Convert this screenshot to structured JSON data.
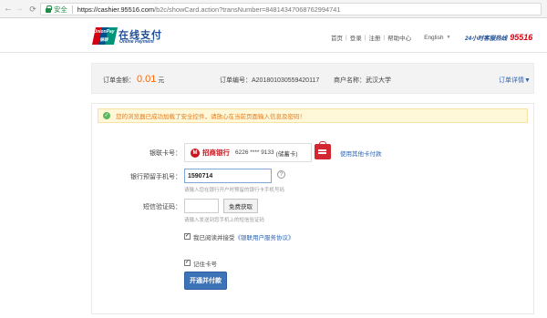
{
  "browser": {
    "secure_label": "安全",
    "url_host": "https://cashier.95516.com",
    "url_path": "/b2c/showCard.action?transNumber=84814347068762994741"
  },
  "header": {
    "logo_cn": "在线支付",
    "logo_en": "Online Payment",
    "logo_mark_top": "UnionPay",
    "logo_mark_bottom": "银联",
    "nav": [
      "首页",
      "登录",
      "注册",
      "帮助中心"
    ],
    "language": "English",
    "hotline_label": "24小时客服热线",
    "hotline_number": "95516"
  },
  "order": {
    "amount_label": "订单金额：",
    "amount_value": "0.01",
    "amount_unit": "元",
    "order_number": "订单编号：A20180103055942011​7",
    "merchant": "商户名称：武汉大学",
    "details_link": "订单详情▼"
  },
  "form": {
    "notice": "您的浏览器已成功加载了安全控件，请放心在当前页面输入信息及密码！",
    "card_label": "银联卡号：",
    "bank_name": "招商银行",
    "card_number": "6226 **** 9133",
    "card_type": "(储蓄卡)",
    "other_card_link": "使用其他卡付款",
    "phone_label": "银行预留手机号：",
    "phone_value": "1590714",
    "phone_hint": "请输入您在银行开户时预留的银行卡手机号码",
    "sms_label": "短信验证码：",
    "sms_placeholder": "",
    "sms_button": "免费获取",
    "sms_hint": "请输入发送到您手机上的短信验证码",
    "agree_text": "我已阅读并接受",
    "agree_link": "《银联用户服务协议》",
    "remember_text": "记住卡号",
    "submit": "开通并付款"
  }
}
